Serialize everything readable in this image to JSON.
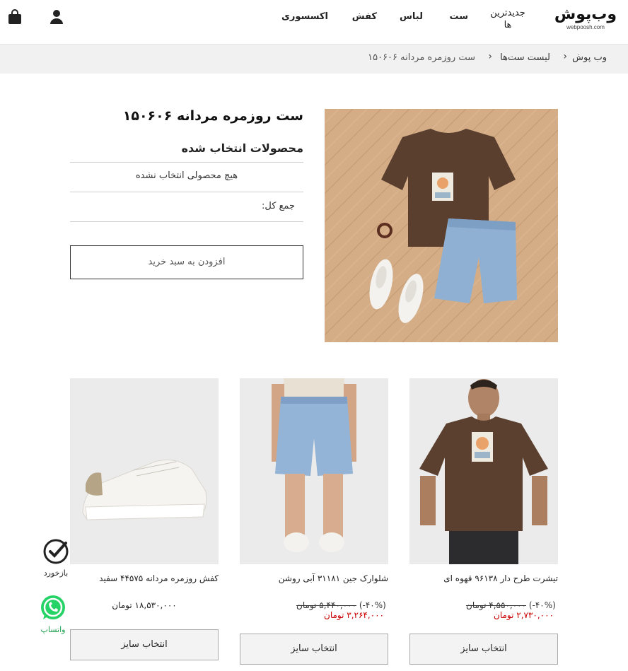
{
  "header": {
    "logo_text": "وب‌پوش",
    "logo_domain": "webpoosh.com",
    "nav": {
      "newest": "جدیدترین ها",
      "set": "ست",
      "clothes": "لباس",
      "shoes": "کفش",
      "accessories": "اکسسوری"
    },
    "icons": {
      "bag": "shopping-bag-icon",
      "user": "user-icon"
    }
  },
  "breadcrumb": {
    "home": "وب پوش",
    "list": "لیست ست‌ها",
    "current": "ست روزمره مردانه ۱۵۰۶۰۶"
  },
  "set": {
    "title": "ست روزمره مردانه ۱۵۰۶۰۶",
    "selected_heading": "محصولات انتخاب شده",
    "none_selected": "هیچ محصولی انتخاب نشده",
    "total_label": "جمع کل:",
    "add_to_cart": "افزودن به سبد خرید"
  },
  "products": [
    {
      "name": "تیشرت طرح دار ۹۶۱۳۸ قهوه ای",
      "discount": "(۴۰%-)",
      "old_price": "۴,۵۵۰,۰۰۰ تومان",
      "new_price": "۲,۷۳۰,۰۰۰ تومان",
      "button": "انتخاب سایز"
    },
    {
      "name": "شلوارک جین ۳۱۱۸۱ آبی روشن",
      "discount": "(۴۰%-)",
      "old_price": "۵,۴۴۰,۰۰۰ تومان",
      "new_price": "۳,۲۶۴,۰۰۰ تومان",
      "button": "انتخاب سایز"
    },
    {
      "name": "کفش روزمره مردانه ۴۴۵۷۵ سفید",
      "price": "۱۸,۵۳۰,۰۰۰ تومان",
      "button": "انتخاب سایز"
    }
  ],
  "floating": {
    "feedback": "بازخورد",
    "whatsapp": "واتساپ"
  },
  "colors": {
    "discount_price": "#cc0000",
    "whatsapp": "#25d366",
    "breadcrumb_bg": "#f1f1f1"
  }
}
